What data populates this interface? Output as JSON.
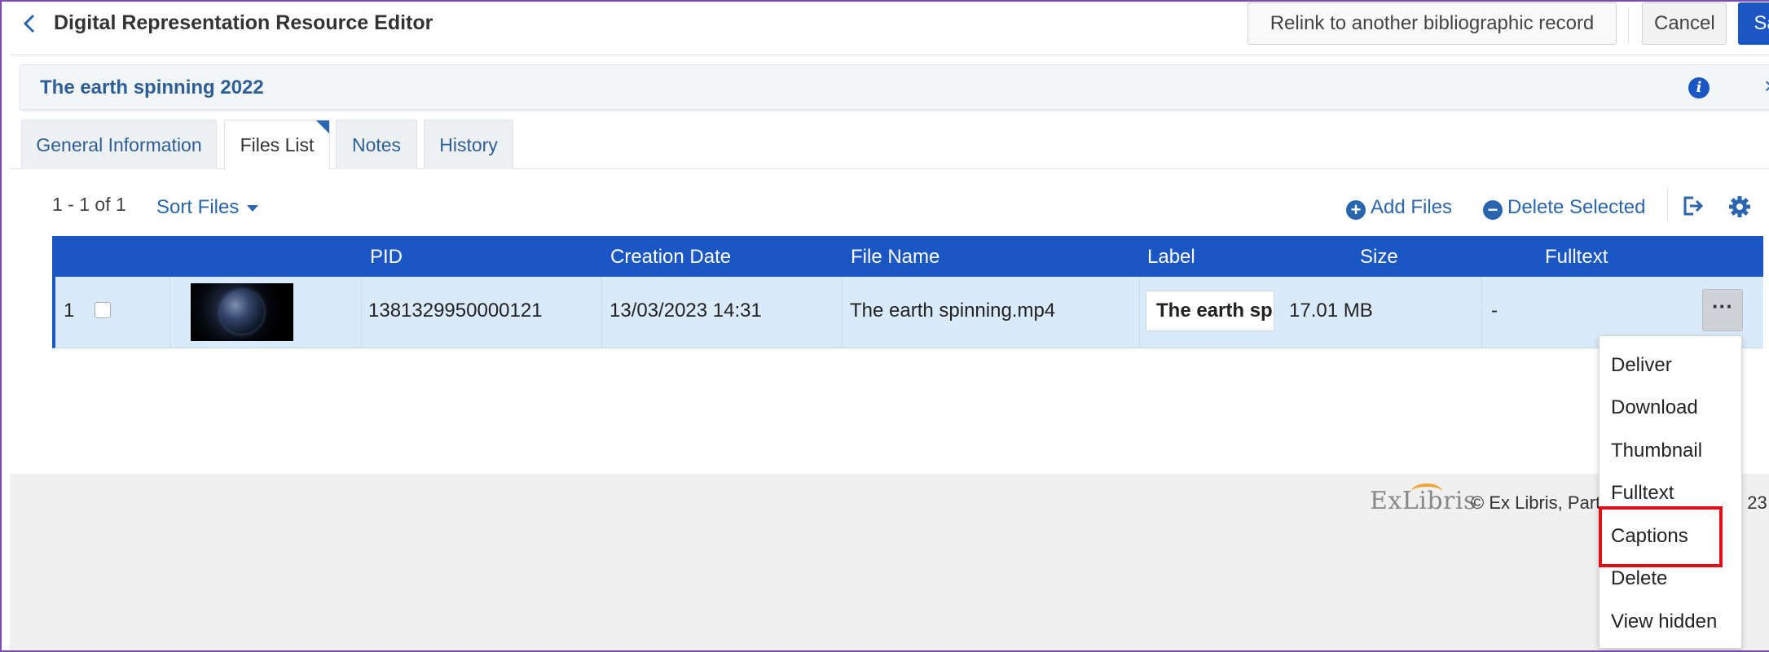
{
  "header": {
    "title": "Digital Representation Resource Editor",
    "relink_label": "Relink to another bibliographic record",
    "cancel_label": "Cancel",
    "save_label": "Sav"
  },
  "record": {
    "title": "The earth spinning 2022",
    "close_glyph": "×"
  },
  "tabs": [
    {
      "label": "General Information",
      "active": false
    },
    {
      "label": "Files List",
      "active": true
    },
    {
      "label": "Notes",
      "active": false
    },
    {
      "label": "History",
      "active": false
    }
  ],
  "toolbar": {
    "count": "1 - 1 of 1",
    "sort_label": "Sort Files",
    "add_files_label": "Add Files",
    "delete_selected_label": "Delete Selected"
  },
  "table": {
    "columns": [
      "PID",
      "Creation Date",
      "File Name",
      "Label",
      "Size",
      "Fulltext"
    ],
    "rows": [
      {
        "index": "1",
        "pid": "1381329950000121",
        "creation_date": "13/03/2023 14:31",
        "file_name": "The earth spinning.mp4",
        "label": "The earth sp",
        "size": "17.01 MB",
        "fulltext": "-",
        "more_glyph": "···"
      }
    ]
  },
  "row_menu": {
    "items": [
      "Deliver",
      "Download",
      "Thumbnail",
      "Fulltext",
      "Captions",
      "Delete",
      "View hidden"
    ],
    "highlighted": "Captions"
  },
  "footer": {
    "logo_text": "ExLibris",
    "copyright": "© Ex Libris, Part",
    "year_tail": "23"
  },
  "colors": {
    "primary": "#1a57c4",
    "link": "#2a65b0",
    "row_selected": "#d9eafb",
    "highlight_border": "#e10e18"
  }
}
